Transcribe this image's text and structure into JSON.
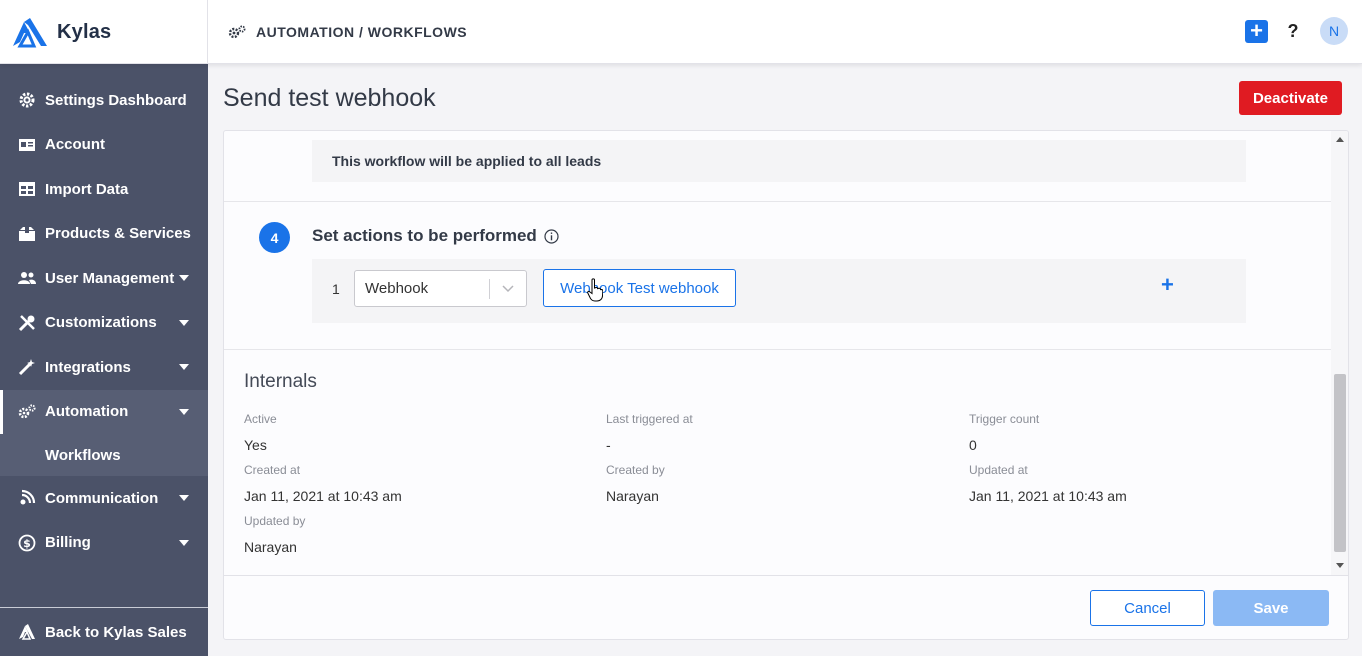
{
  "brand": {
    "name": "Kylas"
  },
  "breadcrumb": {
    "text": "AUTOMATION / WORKFLOWS"
  },
  "header": {
    "avatar_initial": "N",
    "help_label": "?",
    "add_label": "+"
  },
  "sidebar": {
    "items": [
      {
        "label": "Settings Dashboard"
      },
      {
        "label": "Account"
      },
      {
        "label": "Import Data"
      },
      {
        "label": "Products & Services"
      },
      {
        "label": "User Management"
      },
      {
        "label": "Customizations"
      },
      {
        "label": "Integrations"
      },
      {
        "label": "Automation"
      },
      {
        "label": "Communication"
      },
      {
        "label": "Billing"
      }
    ],
    "sub_item": {
      "label": "Workflows"
    },
    "footer": {
      "label": "Back to Kylas Sales"
    }
  },
  "page": {
    "title": "Send test webhook",
    "deactivate_label": "Deactivate"
  },
  "conditions": {
    "applied_text": "This workflow will be applied to all leads"
  },
  "actions": {
    "step_number": "4",
    "title": "Set actions to be performed",
    "row_index": "1",
    "action_type": "Webhook",
    "webhook_label": "Webhook Test webhook",
    "add_label": "+"
  },
  "internals": {
    "title": "Internals",
    "fields": [
      {
        "label": "Active",
        "value": "Yes"
      },
      {
        "label": "Last triggered at",
        "value": "-"
      },
      {
        "label": "Trigger count",
        "value": "0"
      },
      {
        "label": "Created at",
        "value": "Jan 11, 2021 at 10:43 am"
      },
      {
        "label": "Created by",
        "value": "Narayan"
      },
      {
        "label": "Updated at",
        "value": "Jan 11, 2021 at 10:43 am"
      },
      {
        "label": "Updated by",
        "value": "Narayan"
      }
    ]
  },
  "footer": {
    "cancel_label": "Cancel",
    "save_label": "Save"
  },
  "colors": {
    "primary": "#1a73e8",
    "danger": "#e01b22",
    "sidebar_bg": "#4b5268",
    "save_disabled": "#8bb9f4"
  }
}
